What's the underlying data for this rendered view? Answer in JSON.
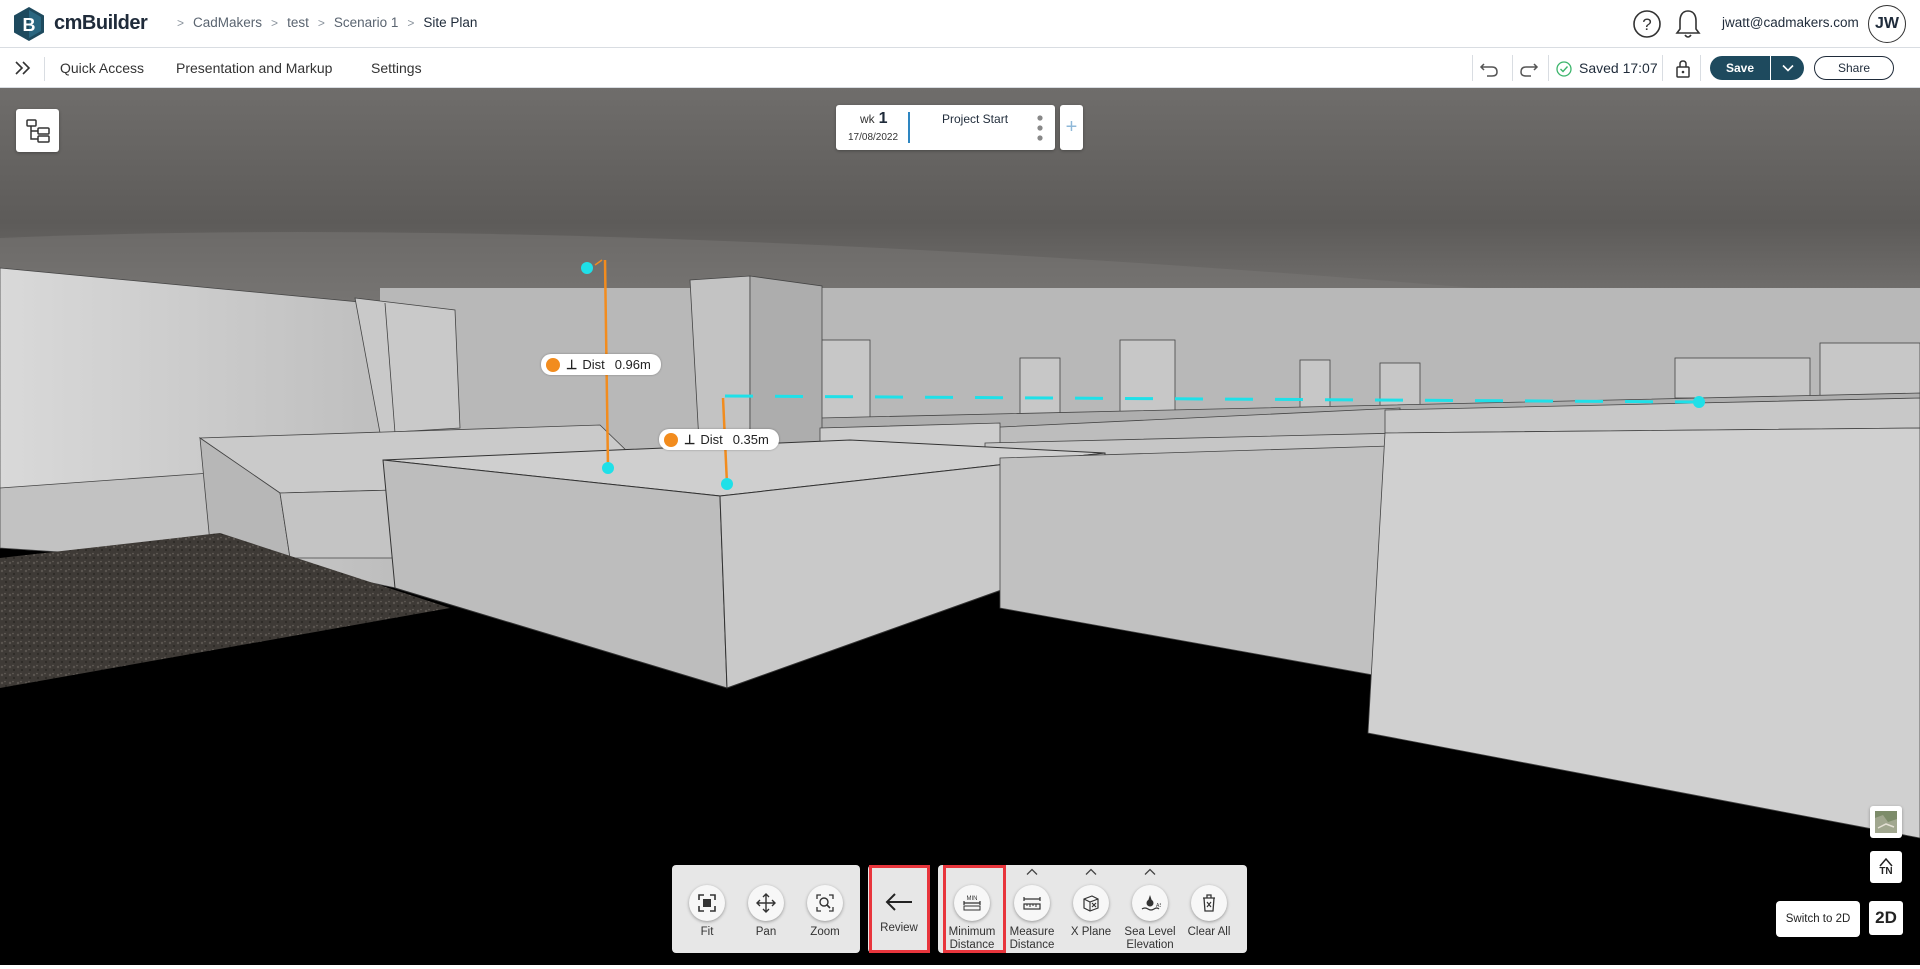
{
  "app": {
    "name": "cmBuilder",
    "logo_letter": "B"
  },
  "breadcrumb": [
    "CadMakers",
    "test",
    "Scenario 1",
    "Site Plan"
  ],
  "header": {
    "user_email": "jwatt@cadmakers.com",
    "avatar_initials": "JW"
  },
  "menu": {
    "items": [
      "Quick Access",
      "Presentation and Markup",
      "Settings"
    ],
    "saved_status": "Saved 17:07",
    "save_label": "Save",
    "share_label": "Share"
  },
  "timeline": {
    "week_prefix": "wk",
    "week_number": "1",
    "date": "17/08/2022",
    "title": "Project Start",
    "add_label": "+"
  },
  "measurements": [
    {
      "name": "Dist",
      "value": "0.96m"
    },
    {
      "name": "Dist",
      "value": "0.35m"
    }
  ],
  "toolbar": {
    "navigation": [
      {
        "label": "Fit",
        "icon": "fit-icon"
      },
      {
        "label": "Pan",
        "icon": "pan-icon"
      },
      {
        "label": "Zoom",
        "icon": "zoom-icon"
      }
    ],
    "review": {
      "label": "Review",
      "icon": "arrow-left-icon"
    },
    "measure": [
      {
        "label": "Minimum Distance",
        "icon": "minimum-distance-icon"
      },
      {
        "label": "Measure Distance",
        "icon": "measure-distance-icon"
      },
      {
        "label": "X Plane",
        "icon": "x-plane-icon"
      },
      {
        "label": "Sea Level Elevation",
        "icon": "sea-level-icon"
      },
      {
        "label": "Clear All",
        "icon": "trash-icon"
      }
    ]
  },
  "right_controls": {
    "north_label": "TN",
    "switch_tooltip": "Switch to 2D",
    "mode_label": "2D"
  },
  "colors": {
    "brand": "#1e4a5e",
    "measure_line": "#f28c1e",
    "measure_point": "#1fe0e8",
    "highlight": "#e8353c"
  }
}
